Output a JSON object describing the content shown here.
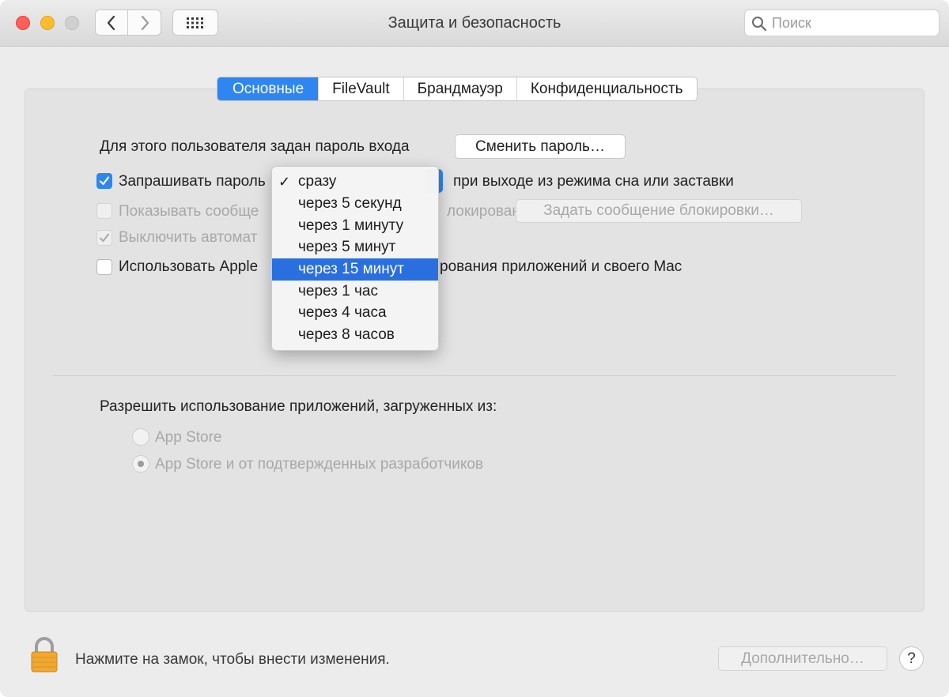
{
  "window": {
    "title": "Защита и безопасность"
  },
  "search": {
    "placeholder": "Поиск"
  },
  "tabs": [
    {
      "label": "Основные",
      "active": true
    },
    {
      "label": "FileVault"
    },
    {
      "label": "Брандмауэр"
    },
    {
      "label": "Конфиденциальность"
    }
  ],
  "general": {
    "password_text": "Для этого пользователя задан пароль входа",
    "change_password_button": "Сменить пароль…",
    "require_password_label": "Запрашивать пароль",
    "require_password_checked": true,
    "require_password_suffix": "при выходе из режима сна или заставки",
    "show_message_label": "Показывать сообщение, когда экран заблокирован",
    "show_message_prefix": "Показывать сообще",
    "show_message_suffix": "локирован",
    "set_lock_message_button": "Задать сообщение блокировки…",
    "disable_autologin_label": "Выключить автомат",
    "disable_autologin_checked": true,
    "apple_watch_prefix": "Использовать Apple",
    "apple_watch_suffix": "рования приложений и своего Mac"
  },
  "dropdown": {
    "checked_index": 0,
    "selected_index": 4,
    "checkmark": "✓",
    "items": [
      "сразу",
      "через 5 секунд",
      "через 1 минуту",
      "через 5 минут",
      "через 15 минут",
      "через 1 час",
      "через 4 часа",
      "через 8 часов"
    ]
  },
  "downloads": {
    "heading": "Разрешить использование приложений, загруженных из:",
    "options": [
      {
        "label": "App Store",
        "selected": false
      },
      {
        "label": "App Store и от подтвержденных разработчиков",
        "selected": true
      }
    ]
  },
  "footer": {
    "lock_text": "Нажмите на замок, чтобы внести изменения.",
    "advanced_button": "Дополнительно…",
    "help_button": "?"
  },
  "colors": {
    "accent": "#2e86f0",
    "selection": "#2a6fe0"
  }
}
